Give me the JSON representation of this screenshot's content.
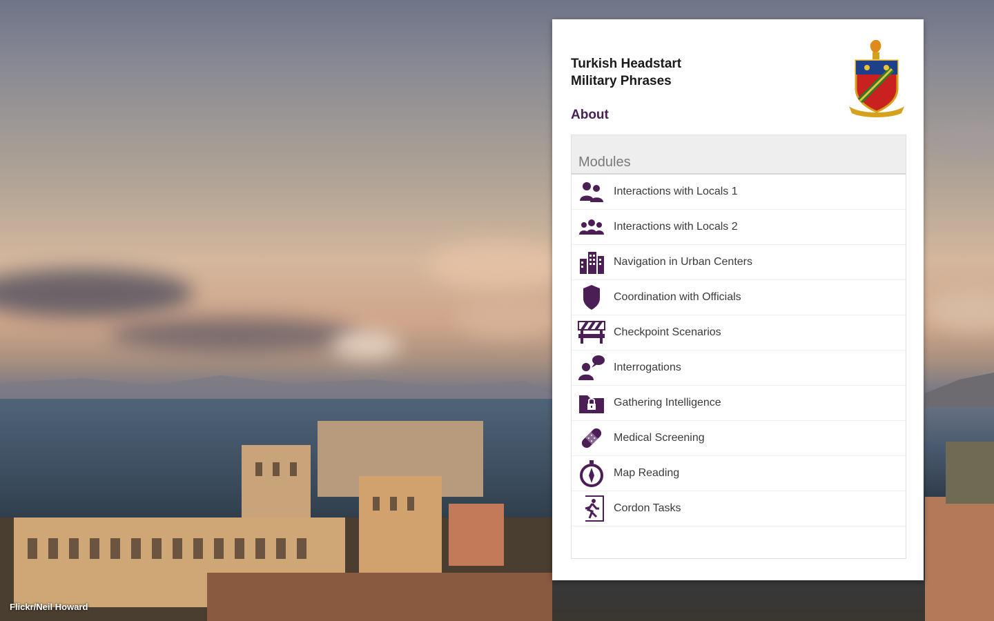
{
  "background": {
    "credit": "Flickr/Neil Howard"
  },
  "app": {
    "title_line1": "Turkish Headstart",
    "title_line2": "Military Phrases",
    "about_label": "About",
    "accent_color": "#4b1e56",
    "crest_icon": "unit-crest-icon"
  },
  "modules": {
    "header": "Modules",
    "items": [
      {
        "label": "Interactions with Locals 1",
        "icon": "two-people-icon"
      },
      {
        "label": "Interactions with Locals 2",
        "icon": "group-people-icon"
      },
      {
        "label": "Navigation in Urban Centers",
        "icon": "buildings-icon"
      },
      {
        "label": "Coordination with Officials",
        "icon": "badge-shield-icon"
      },
      {
        "label": "Checkpoint Scenarios",
        "icon": "barrier-icon"
      },
      {
        "label": "Interrogations",
        "icon": "speech-person-icon"
      },
      {
        "label": "Gathering Intelligence",
        "icon": "locked-folder-icon"
      },
      {
        "label": "Medical Screening",
        "icon": "bandage-icon"
      },
      {
        "label": "Map Reading",
        "icon": "compass-icon"
      },
      {
        "label": "Cordon Tasks",
        "icon": "exit-runner-icon"
      }
    ]
  }
}
